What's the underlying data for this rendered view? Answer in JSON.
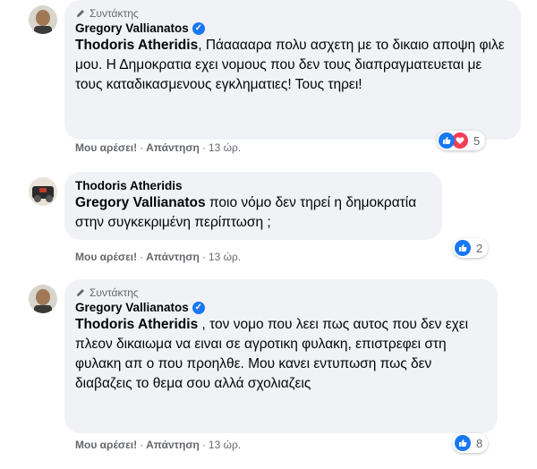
{
  "comments": [
    {
      "badge": "Συντάκτης",
      "author": "Gregory Vallianatos",
      "verified": true,
      "mention": "Thodoris Atheridis",
      "text": ", Πάααααρα πολυ ασχετη με το δικαιο αποψη φιλε μου. Η Δημοκρατια εχει νομους που δεν τους διαπραγματευεται με τους καταδικασμενους εγκληματιες! Τους τηρει!",
      "like_label": "Μου αρέσει!",
      "reply_label": "Απάντηση",
      "time": "13 ώρ.",
      "reaction_count": "5",
      "reactions": [
        "like-icon",
        "love-icon"
      ]
    },
    {
      "author": "Thodoris Atheridis",
      "verified": false,
      "mention": "Gregory Vallianatos",
      "text": " ποιο νόμο δεν τηρεί η δημοκρατία στην συγκεκριμένη περίπτωση ;",
      "like_label": "Μου αρέσει!",
      "reply_label": "Απάντηση",
      "time": "13 ώρ.",
      "reaction_count": "2",
      "reactions": [
        "like-icon"
      ]
    },
    {
      "badge": "Συντάκτης",
      "author": "Gregory Vallianatos",
      "verified": true,
      "mention": "Thodoris Atheridis",
      "text": " , τον νομο που λεει πως αυτος που δεν εχει πλεον δικαιωμα να ειναι σε αγροτικη φυλακη, επιστρεφει στη φυλακη απ ο που προηλθε. Μου κανει εντυπωση πως δεν διαβαζεις το θεμα σου αλλά σχολιαζεις",
      "like_label": "Μου αρέσει!",
      "reply_label": "Απάντηση",
      "time": "13 ώρ.",
      "reaction_count": "8",
      "reactions": [
        "like-icon"
      ]
    }
  ],
  "colors": {
    "bubble": "#f0f2f5",
    "meta": "#65676b",
    "like": "#1877f2",
    "love": "#f33e58"
  }
}
